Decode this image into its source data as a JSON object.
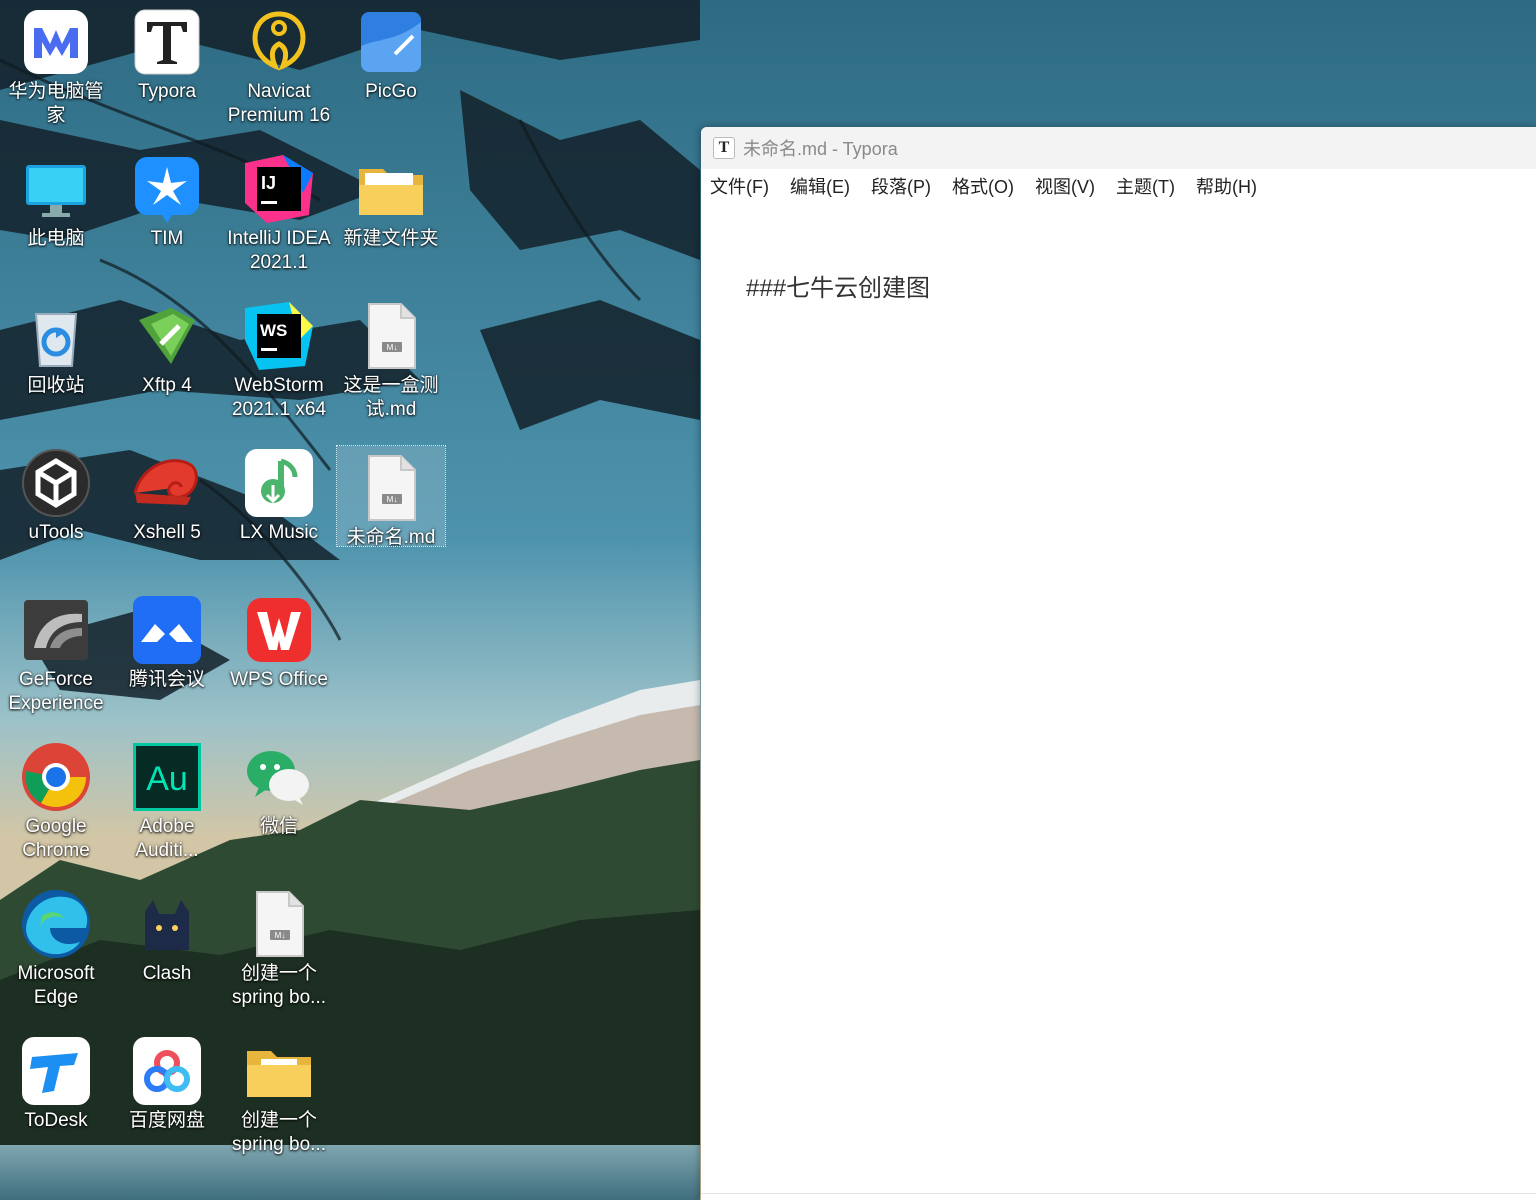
{
  "desktop": {
    "icons": [
      {
        "label": "华为电脑管家",
        "icon": "huawei-pc-manager-icon"
      },
      {
        "label": "Typora",
        "icon": "typora-icon"
      },
      {
        "label": "Navicat\nPremium 16",
        "icon": "navicat-icon"
      },
      {
        "label": "PicGo",
        "icon": "picgo-icon"
      },
      {
        "label": "此电脑",
        "icon": "this-pc-icon"
      },
      {
        "label": "TIM",
        "icon": "tim-icon"
      },
      {
        "label": "IntelliJ IDEA\n2021.1",
        "icon": "intellij-idea-icon"
      },
      {
        "label": "新建文件夹",
        "icon": "folder-icon"
      },
      {
        "label": "回收站",
        "icon": "recycle-bin-icon"
      },
      {
        "label": "Xftp 4",
        "icon": "xftp-icon"
      },
      {
        "label": "WebStorm\n2021.1 x64",
        "icon": "webstorm-icon"
      },
      {
        "label": "这是一盒测\n试.md",
        "icon": "markdown-file-icon"
      },
      {
        "label": "uTools",
        "icon": "utools-icon"
      },
      {
        "label": "Xshell 5",
        "icon": "xshell-icon"
      },
      {
        "label": "LX Music",
        "icon": "lx-music-icon"
      },
      {
        "label": "未命名.md",
        "icon": "markdown-file-icon"
      },
      {
        "label": "GeForce\nExperience",
        "icon": "geforce-experience-icon"
      },
      {
        "label": "腾讯会议",
        "icon": "tencent-meeting-icon"
      },
      {
        "label": "WPS Office",
        "icon": "wps-office-icon"
      },
      {
        "label": "Google\nChrome",
        "icon": "chrome-icon"
      },
      {
        "label": "Adobe\nAuditi...",
        "icon": "adobe-audition-icon"
      },
      {
        "label": "微信",
        "icon": "wechat-icon"
      },
      {
        "label": "Microsoft\nEdge",
        "icon": "edge-icon"
      },
      {
        "label": "Clash",
        "icon": "clash-icon"
      },
      {
        "label": "创建一个\nspring bo...",
        "icon": "markdown-file-icon"
      },
      {
        "label": "ToDesk",
        "icon": "todesk-icon"
      },
      {
        "label": "百度网盘",
        "icon": "baidu-netdisk-icon"
      },
      {
        "label": "创建一个\nspring bo...",
        "icon": "folder-icon"
      }
    ]
  },
  "typora": {
    "title": "未命名.md - Typora",
    "app_icon_letter": "T",
    "menu": [
      "文件(F)",
      "编辑(E)",
      "段落(P)",
      "格式(O)",
      "视图(V)",
      "主题(T)",
      "帮助(H)"
    ],
    "content": "###七牛云创建图"
  },
  "colors": {
    "accent_blue": "#1a73e8",
    "sky": "#3f86a3",
    "forest": "#23362a",
    "water": "#5c8a9a"
  }
}
